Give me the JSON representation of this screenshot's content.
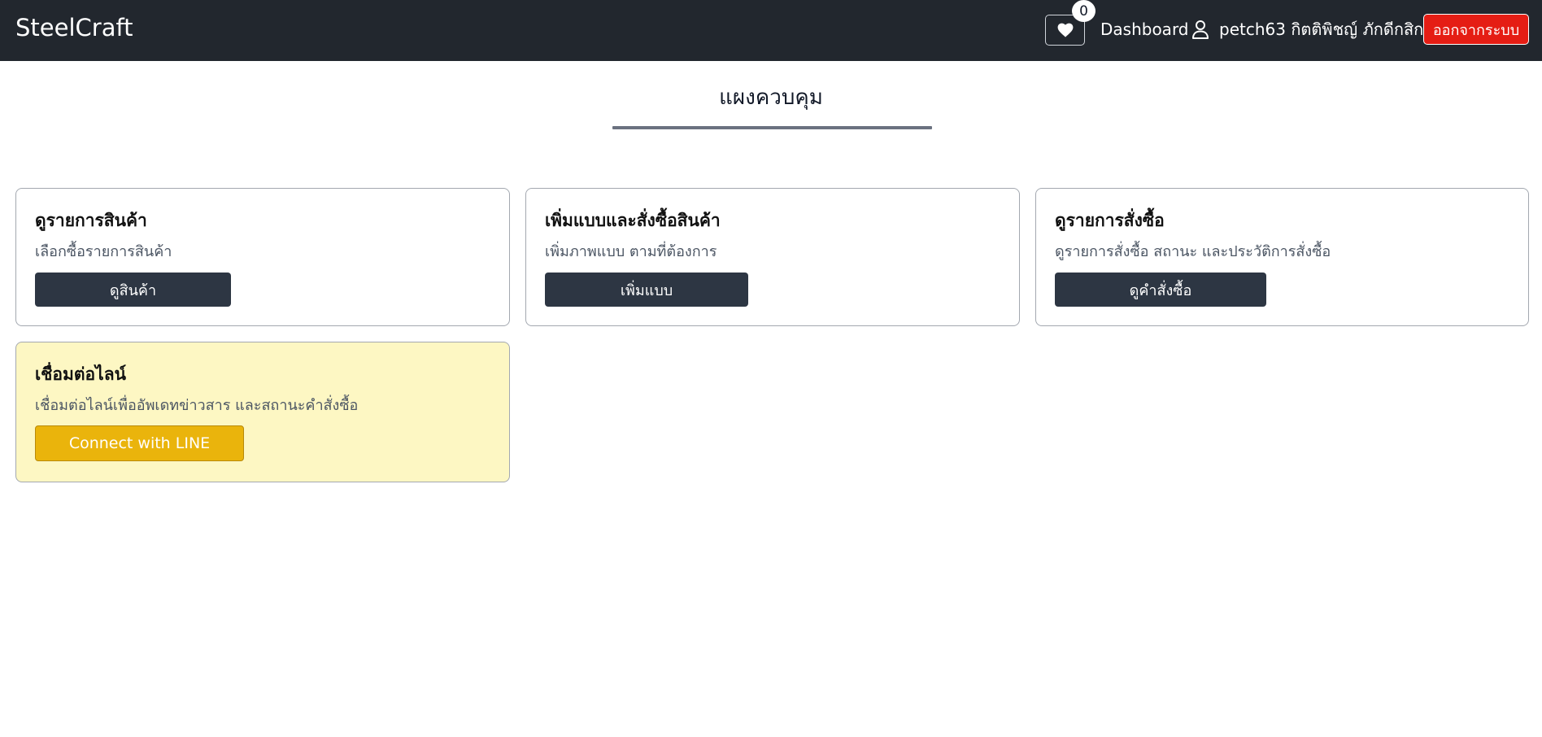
{
  "app": {
    "brand": "SteelCraft"
  },
  "navbar": {
    "favorites_count": "0",
    "dashboard_label": "Dashboard",
    "user_name": "petch63 กิตติพิชญ์ ภักดีกสิกร",
    "logout_label": "ออกจากระบบ",
    "icons": {
      "favorites": "heart-icon",
      "user": "user-icon"
    }
  },
  "page": {
    "title": "แผงควบคุม"
  },
  "cards": [
    {
      "title": "ดูรายการสินค้า",
      "description": "เลือกซื้อรายการสินค้า",
      "button_label": "ดูสินค้า"
    },
    {
      "title": "เพิ่มแบบและสั่งซื้อสินค้า",
      "description": "เพิ่มภาพแบบ ตามที่ต้องการ",
      "button_label": "เพิ่มแบบ"
    },
    {
      "title": "ดูรายการสั่งซื้อ",
      "description": "ดูรายการสั่งซื้อ สถานะ และประวัติการสั่งซื้อ",
      "button_label": "ดูคำสั่งซื้อ"
    },
    {
      "title": "เชื่อมต่อไลน์",
      "description": "เชื่อมต่อไลน์เพื่ออัพเดทข่าวสาร และสถานะคำสั่งซื้อ",
      "button_label": "Connect with LINE"
    }
  ],
  "colors": {
    "navbar_bg": "#22272e",
    "logout_bg": "#e51d14",
    "card_button_bg": "#2d3643",
    "line_card_bg": "#fdf7c3",
    "line_button_bg": "#eab40c"
  }
}
